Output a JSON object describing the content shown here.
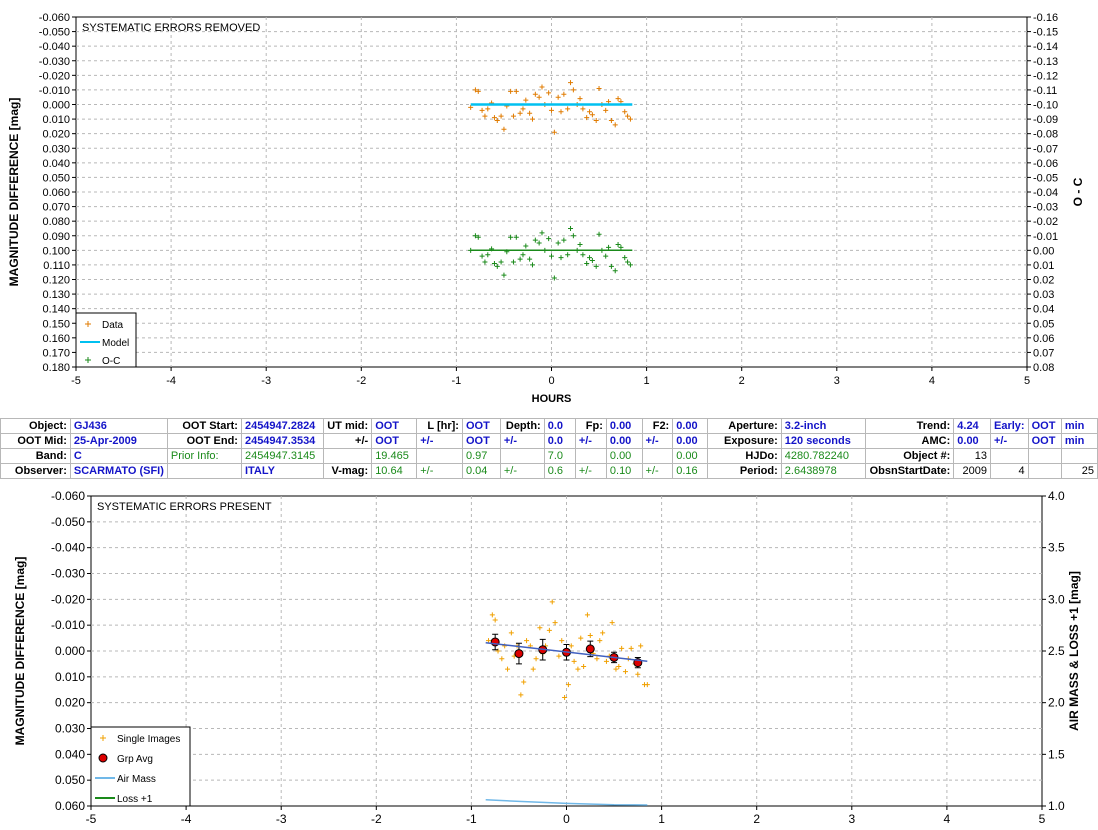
{
  "chart_data": [
    {
      "type": "scatter",
      "title": "SYSTEMATIC ERRORS REMOVED",
      "xlabel": "HOURS",
      "ylabel": "MAGNITUDE DIFFERENCE [mag]",
      "y2label": "O - C",
      "xlim": [
        -5,
        5
      ],
      "ylim": [
        -0.06,
        0.18
      ],
      "y2lim": [
        -0.16,
        0.08
      ],
      "y_inverted": true,
      "y2_inverted": true,
      "x_ticks": [
        "-5",
        "-4",
        "-3",
        "-2",
        "-1",
        "0",
        "1",
        "2",
        "3",
        "4",
        "5"
      ],
      "y_ticks": [
        "-0.060",
        "-0.050",
        "-0.040",
        "-0.030",
        "-0.020",
        "-0.010",
        "0.000",
        "0.010",
        "0.020",
        "0.030",
        "0.040",
        "0.050",
        "0.060",
        "0.070",
        "0.080",
        "0.090",
        "0.100",
        "0.110",
        "0.120",
        "0.130",
        "0.140",
        "0.150",
        "0.160",
        "0.170",
        "0.180"
      ],
      "y2_ticks": [
        "-0.16",
        "-0.15",
        "-0.14",
        "-0.13",
        "-0.12",
        "-0.11",
        "-0.10",
        "-0.09",
        "-0.08",
        "-0.07",
        "-0.06",
        "-0.05",
        "-0.04",
        "-0.03",
        "-0.02",
        "-0.01",
        "0.00",
        "0.01",
        "0.02",
        "0.03",
        "0.04",
        "0.05",
        "0.06",
        "0.07",
        "0.08"
      ],
      "grid": true,
      "legend_position": "bottom-left",
      "legend": [
        "Data",
        "Model",
        "O-C"
      ],
      "series": [
        {
          "name": "Data",
          "color": "#e07b00",
          "marker": "plus",
          "x": [
            -0.85,
            -0.8,
            -0.77,
            -0.73,
            -0.7,
            -0.67,
            -0.63,
            -0.6,
            -0.57,
            -0.53,
            -0.5,
            -0.47,
            -0.43,
            -0.4,
            -0.37,
            -0.33,
            -0.3,
            -0.27,
            -0.23,
            -0.2,
            -0.17,
            -0.13,
            -0.1,
            -0.07,
            -0.03,
            0.0,
            0.03,
            0.07,
            0.1,
            0.13,
            0.17,
            0.2,
            0.23,
            0.27,
            0.3,
            0.33,
            0.37,
            0.4,
            0.43,
            0.47,
            0.5,
            0.53,
            0.57,
            0.6,
            0.63,
            0.67,
            0.7,
            0.73,
            0.77,
            0.8,
            0.83
          ],
          "y": [
            0.002,
            -0.01,
            -0.009,
            0.004,
            0.008,
            0.003,
            -0.001,
            0.009,
            0.011,
            0.008,
            0.017,
            0.001,
            -0.009,
            0.008,
            -0.009,
            0.006,
            0.003,
            -0.003,
            0.006,
            0.01,
            -0.007,
            -0.005,
            -0.012,
            0.0,
            -0.008,
            0.004,
            0.019,
            -0.005,
            0.005,
            -0.007,
            0.003,
            -0.015,
            -0.01,
            0.0,
            -0.004,
            0.003,
            0.009,
            0.005,
            0.007,
            0.011,
            -0.011,
            0.0,
            0.004,
            -0.002,
            0.011,
            0.014,
            -0.004,
            -0.002,
            0.005,
            0.008,
            0.01
          ]
        },
        {
          "name": "Model",
          "color": "#00c0f0",
          "marker": "line",
          "x": [
            -0.85,
            0.85
          ],
          "y": [
            0.0,
            0.0
          ]
        },
        {
          "name": "O-C",
          "color": "#1a8a1a",
          "marker": "plus",
          "axis": "right",
          "x": [
            -0.85,
            -0.8,
            -0.77,
            -0.73,
            -0.7,
            -0.67,
            -0.63,
            -0.6,
            -0.57,
            -0.53,
            -0.5,
            -0.47,
            -0.43,
            -0.4,
            -0.37,
            -0.33,
            -0.3,
            -0.27,
            -0.23,
            -0.2,
            -0.17,
            -0.13,
            -0.1,
            -0.07,
            -0.03,
            0.0,
            0.03,
            0.07,
            0.1,
            0.13,
            0.17,
            0.2,
            0.23,
            0.27,
            0.3,
            0.33,
            0.37,
            0.4,
            0.43,
            0.47,
            0.5,
            0.53,
            0.57,
            0.6,
            0.63,
            0.67,
            0.7,
            0.73,
            0.77,
            0.8,
            0.83
          ],
          "y": [
            0.0,
            -0.01,
            -0.009,
            0.004,
            0.008,
            0.003,
            -0.001,
            0.009,
            0.011,
            0.008,
            0.017,
            0.001,
            -0.009,
            0.008,
            -0.009,
            0.006,
            0.003,
            -0.003,
            0.006,
            0.01,
            -0.007,
            -0.005,
            -0.012,
            0.0,
            -0.008,
            0.004,
            0.019,
            -0.005,
            0.005,
            -0.007,
            0.003,
            -0.015,
            -0.01,
            0.0,
            -0.004,
            0.003,
            0.009,
            0.005,
            0.007,
            0.011,
            -0.011,
            0.0,
            0.004,
            -0.002,
            0.011,
            0.014,
            -0.004,
            -0.002,
            0.005,
            0.008,
            0.01
          ]
        },
        {
          "name": "O-C zero",
          "color": "#1a8a1a",
          "marker": "line",
          "axis": "right",
          "x": [
            -0.85,
            0.85
          ],
          "y": [
            0.0,
            0.0
          ]
        }
      ]
    },
    {
      "type": "scatter",
      "title": "SYSTEMATIC ERRORS PRESENT",
      "xlabel": "",
      "ylabel": "MAGNITUDE DIFFERENCE [mag]",
      "y2label": "AIR MASS & LOSS +1 [mag]",
      "xlim": [
        -5,
        5
      ],
      "ylim": [
        -0.06,
        0.06
      ],
      "y2lim": [
        1.0,
        4.0
      ],
      "y_inverted": true,
      "x_ticks": [
        "-5",
        "-4",
        "-3",
        "-2",
        "-1",
        "0",
        "1",
        "2",
        "3",
        "4",
        "5"
      ],
      "y_ticks": [
        "-0.060",
        "-0.050",
        "-0.040",
        "-0.030",
        "-0.020",
        "-0.010",
        "0.000",
        "0.010",
        "0.020",
        "0.030",
        "0.040",
        "0.050",
        "0.060"
      ],
      "y2_ticks": [
        "4.0",
        "3.5",
        "3.0",
        "2.5",
        "2.0",
        "1.5",
        "1.0"
      ],
      "grid": true,
      "legend_position": "bottom-left",
      "legend": [
        "Single Images",
        "Grp Avg",
        "Air Mass",
        "Loss +1"
      ],
      "series": [
        {
          "name": "Single Images",
          "color": "#f0a000",
          "marker": "plus",
          "x": [
            -0.82,
            -0.78,
            -0.75,
            -0.72,
            -0.68,
            -0.65,
            -0.62,
            -0.58,
            -0.55,
            -0.52,
            -0.48,
            -0.45,
            -0.42,
            -0.38,
            -0.35,
            -0.32,
            -0.28,
            -0.25,
            -0.22,
            -0.18,
            -0.15,
            -0.12,
            -0.08,
            -0.05,
            -0.02,
            0.02,
            0.05,
            0.08,
            0.12,
            0.15,
            0.18,
            0.22,
            0.25,
            0.28,
            0.32,
            0.35,
            0.38,
            0.42,
            0.45,
            0.48,
            0.52,
            0.55,
            0.58,
            0.62,
            0.65,
            0.68,
            0.72,
            0.75,
            0.78,
            0.82,
            0.85
          ],
          "y": [
            -0.004,
            -0.014,
            -0.012,
            0.0,
            0.003,
            -0.002,
            0.007,
            -0.007,
            0.002,
            -0.002,
            0.017,
            0.012,
            -0.004,
            -0.002,
            0.007,
            0.003,
            -0.009,
            0.001,
            -0.002,
            -0.008,
            -0.019,
            -0.011,
            0.002,
            -0.004,
            0.018,
            0.013,
            -0.002,
            0.004,
            0.007,
            -0.005,
            0.006,
            -0.014,
            -0.006,
            0.001,
            0.003,
            -0.004,
            -0.007,
            0.004,
            0.002,
            -0.011,
            0.007,
            0.006,
            -0.001,
            0.008,
            0.003,
            -0.001,
            0.005,
            0.009,
            -0.002,
            0.013,
            0.013
          ]
        },
        {
          "name": "Grp Avg",
          "color": "#dd0000",
          "marker": "dot",
          "x": [
            -0.75,
            -0.5,
            -0.25,
            0.0,
            0.25,
            0.5,
            0.75
          ],
          "y": [
            -0.0035,
            0.001,
            -0.0005,
            0.0005,
            -0.0008,
            0.0025,
            0.0045
          ],
          "err": [
            0.003,
            0.004,
            0.004,
            0.003,
            0.003,
            0.002,
            0.002
          ]
        },
        {
          "name": "Model",
          "color": "#4060c0",
          "marker": "line",
          "x": [
            -0.85,
            0.85
          ],
          "y": [
            -0.0032,
            0.004
          ]
        },
        {
          "name": "Air Mass",
          "color": "#70b8e8",
          "marker": "line",
          "axis": "right",
          "x": [
            -0.85,
            -0.5,
            0.0,
            0.5,
            0.85
          ],
          "y": [
            1.06,
            1.045,
            1.025,
            1.012,
            1.01
          ]
        },
        {
          "name": "Loss +1",
          "color": "#1a8a1a",
          "marker": "line",
          "axis": "right",
          "x": [],
          "y": []
        }
      ]
    }
  ],
  "info_table": [
    [
      {
        "t": "Object:",
        "c": "l"
      },
      {
        "t": "GJ436",
        "c": "v"
      },
      {
        "t": "OOT Start:",
        "c": "l"
      },
      {
        "t": "2454947.2824",
        "c": "v"
      },
      {
        "t": "UT mid:",
        "c": "l"
      },
      {
        "t": "OOT",
        "c": "v"
      },
      {
        "t": "L [hr]:",
        "c": "l"
      },
      {
        "t": "OOT",
        "c": "v"
      },
      {
        "t": "Depth:",
        "c": "l"
      },
      {
        "t": "0.0",
        "c": "v"
      },
      {
        "t": "Fp:",
        "c": "l"
      },
      {
        "t": "0.00",
        "c": "v"
      },
      {
        "t": "F2:",
        "c": "l"
      },
      {
        "t": "0.00",
        "c": "v"
      },
      {
        "t": "Aperture:",
        "c": "l"
      },
      {
        "t": "3.2-inch",
        "c": "v"
      },
      {
        "t": "Trend:",
        "c": "l"
      },
      {
        "t": "4.24",
        "c": "v"
      },
      {
        "t": "Early:",
        "c": "v"
      },
      {
        "t": "OOT",
        "c": "v"
      },
      {
        "t": "min",
        "c": "v"
      }
    ],
    [
      {
        "t": "OOT Mid:",
        "c": "l"
      },
      {
        "t": "25-Apr-2009",
        "c": "v"
      },
      {
        "t": "OOT End:",
        "c": "l"
      },
      {
        "t": "2454947.3534",
        "c": "v"
      },
      {
        "t": "+/-",
        "c": "l"
      },
      {
        "t": "OOT",
        "c": "v"
      },
      {
        "t": "+/-",
        "c": "v"
      },
      {
        "t": "OOT",
        "c": "v"
      },
      {
        "t": "+/-",
        "c": "v"
      },
      {
        "t": "0.0",
        "c": "v"
      },
      {
        "t": "+/-",
        "c": "v"
      },
      {
        "t": "0.00",
        "c": "v"
      },
      {
        "t": "+/-",
        "c": "v"
      },
      {
        "t": "0.00",
        "c": "v"
      },
      {
        "t": "Exposure:",
        "c": "l"
      },
      {
        "t": "120 seconds",
        "c": "v"
      },
      {
        "t": "AMC:",
        "c": "l"
      },
      {
        "t": "0.00",
        "c": "v"
      },
      {
        "t": "+/-",
        "c": "v"
      },
      {
        "t": "OOT",
        "c": "v"
      },
      {
        "t": "min",
        "c": "v"
      }
    ],
    [
      {
        "t": "Band:",
        "c": "l"
      },
      {
        "t": "C",
        "c": "v"
      },
      {
        "t": "Prior Info:",
        "c": "g"
      },
      {
        "t": "2454947.3145",
        "c": "g"
      },
      {
        "t": "",
        "c": "g"
      },
      {
        "t": "19.465",
        "c": "g"
      },
      {
        "t": "",
        "c": "g"
      },
      {
        "t": "0.97",
        "c": "g"
      },
      {
        "t": "",
        "c": "g"
      },
      {
        "t": "7.0",
        "c": "g"
      },
      {
        "t": "",
        "c": "g"
      },
      {
        "t": "0.00",
        "c": "g"
      },
      {
        "t": "",
        "c": "g"
      },
      {
        "t": "0.00",
        "c": "g"
      },
      {
        "t": "HJDo:",
        "c": "l"
      },
      {
        "t": "4280.782240",
        "c": "g"
      },
      {
        "t": "Object #:",
        "c": "l"
      },
      {
        "t": "13",
        "c": "n"
      },
      {
        "t": "",
        "c": "n"
      },
      {
        "t": "",
        "c": "n"
      },
      {
        "t": "",
        "c": "n"
      }
    ],
    [
      {
        "t": "Observer:",
        "c": "l"
      },
      {
        "t": "SCARMATO (SFI)",
        "c": "v"
      },
      {
        "t": "",
        "c": "l"
      },
      {
        "t": "ITALY",
        "c": "v"
      },
      {
        "t": "V-mag:",
        "c": "l"
      },
      {
        "t": "10.64",
        "c": "g"
      },
      {
        "t": "+/-",
        "c": "g"
      },
      {
        "t": "0.04",
        "c": "g"
      },
      {
        "t": "+/-",
        "c": "g"
      },
      {
        "t": "0.6",
        "c": "g"
      },
      {
        "t": "+/-",
        "c": "g"
      },
      {
        "t": "0.10",
        "c": "g"
      },
      {
        "t": "+/-",
        "c": "g"
      },
      {
        "t": "0.16",
        "c": "g"
      },
      {
        "t": "Period:",
        "c": "l"
      },
      {
        "t": "2.6438978",
        "c": "g"
      },
      {
        "t": "ObsnStartDate:",
        "c": "l"
      },
      {
        "t": "2009",
        "c": "n"
      },
      {
        "t": "4",
        "c": "n"
      },
      {
        "t": "",
        "c": "n"
      },
      {
        "t": "25",
        "c": "n"
      }
    ]
  ]
}
